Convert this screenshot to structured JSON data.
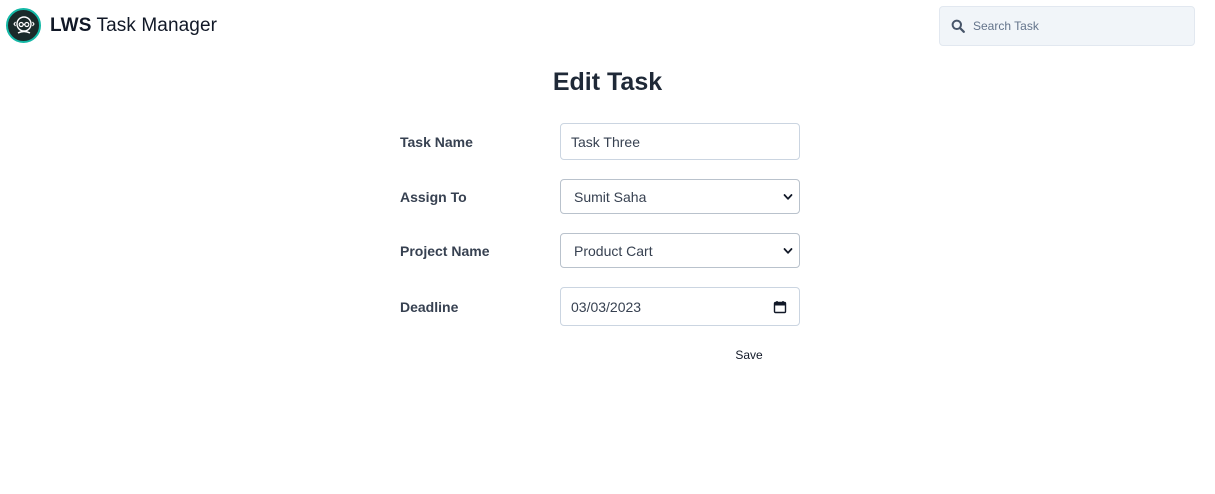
{
  "brand": {
    "strong": "LWS",
    "rest": " Task Manager"
  },
  "search": {
    "placeholder": "Search Task"
  },
  "page": {
    "title": "Edit Task"
  },
  "form": {
    "task_name": {
      "label": "Task Name",
      "value": "Task Three"
    },
    "assign_to": {
      "label": "Assign To",
      "value": "Sumit Saha"
    },
    "project_name": {
      "label": "Project Name",
      "value": "Product Cart"
    },
    "deadline": {
      "label": "Deadline",
      "value": "03/03/2023"
    },
    "save_label": "Save"
  },
  "colors": {
    "logo_ring": "#14b8a6",
    "search_bg": "#f1f5f9"
  },
  "icons": {
    "logo": "coder-logo-icon",
    "search": "search-icon",
    "dropdown": "chevron-down-icon",
    "calendar": "calendar-icon"
  }
}
